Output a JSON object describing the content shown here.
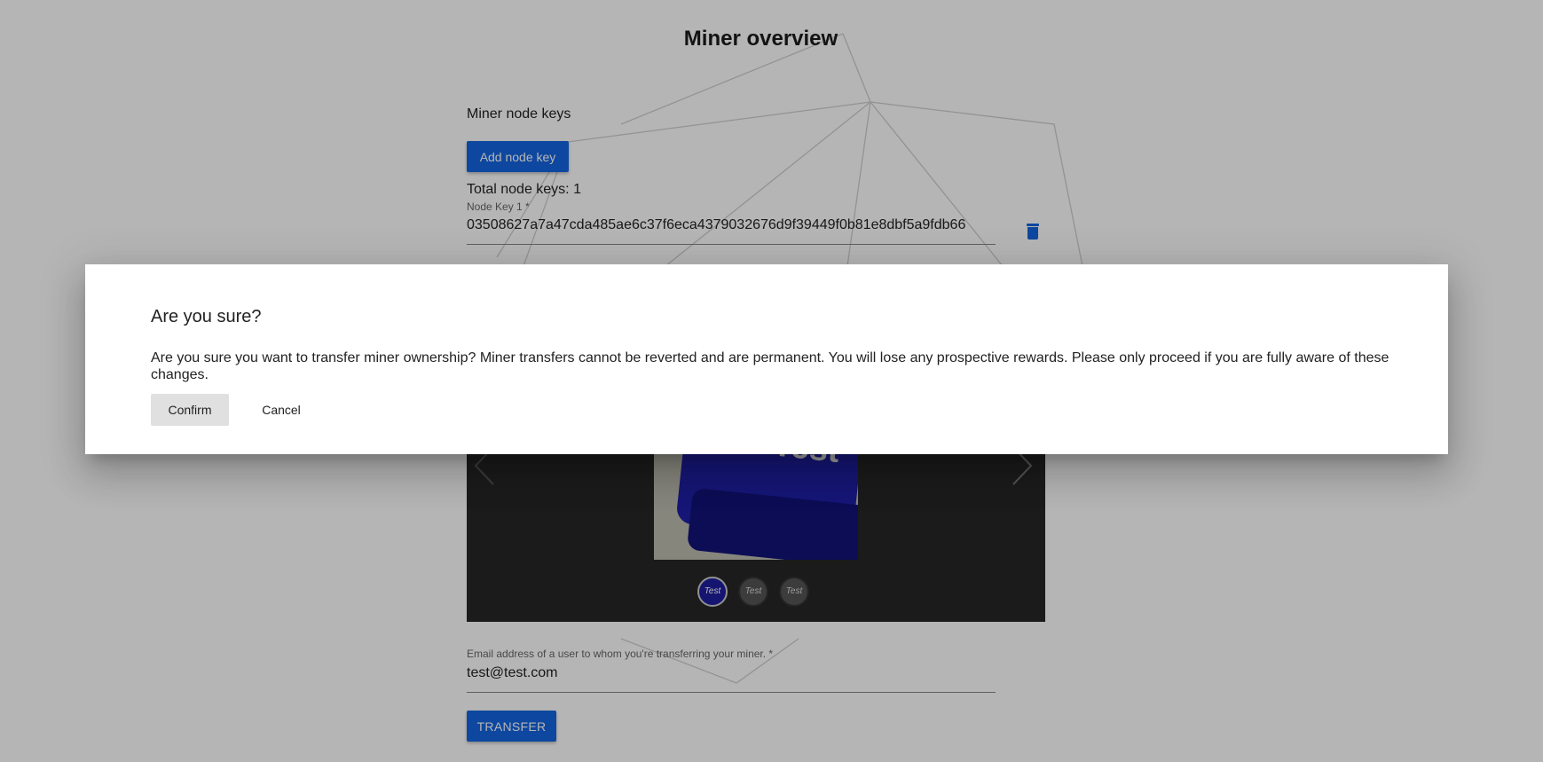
{
  "page": {
    "title": "Miner overview"
  },
  "node_keys": {
    "section_label": "Miner node keys",
    "add_button_label": "Add node key",
    "total_label": "Total node keys: 1",
    "key_field_label": "Node Key 1 *",
    "key_value": "03508627a7a47cda485ae6c37f6eca4379032676d9f39449f0b81e8dbf5a9fdb66"
  },
  "carousel": {
    "slide_text": "Test",
    "dots": [
      "Test",
      "Test",
      "Test"
    ],
    "active_index": 0
  },
  "transfer": {
    "email_label": "Email address of a user to whom you're transferring your miner. *",
    "email_value": "test@test.com",
    "button_label": "TRANSFER"
  },
  "dialog": {
    "title": "Are you sure?",
    "message": "Are you sure you want to transfer miner ownership? Miner transfers cannot be reverted and are permanent. You will lose any prospective rewards. Please only proceed if you are fully aware of these changes.",
    "confirm_label": "Confirm",
    "cancel_label": "Cancel"
  },
  "colors": {
    "accent": "#1565e0",
    "overlay": "rgba(0,0,0,0.29)"
  },
  "icons": [
    "trash-icon",
    "chevron-left-icon",
    "chevron-right-icon"
  ]
}
